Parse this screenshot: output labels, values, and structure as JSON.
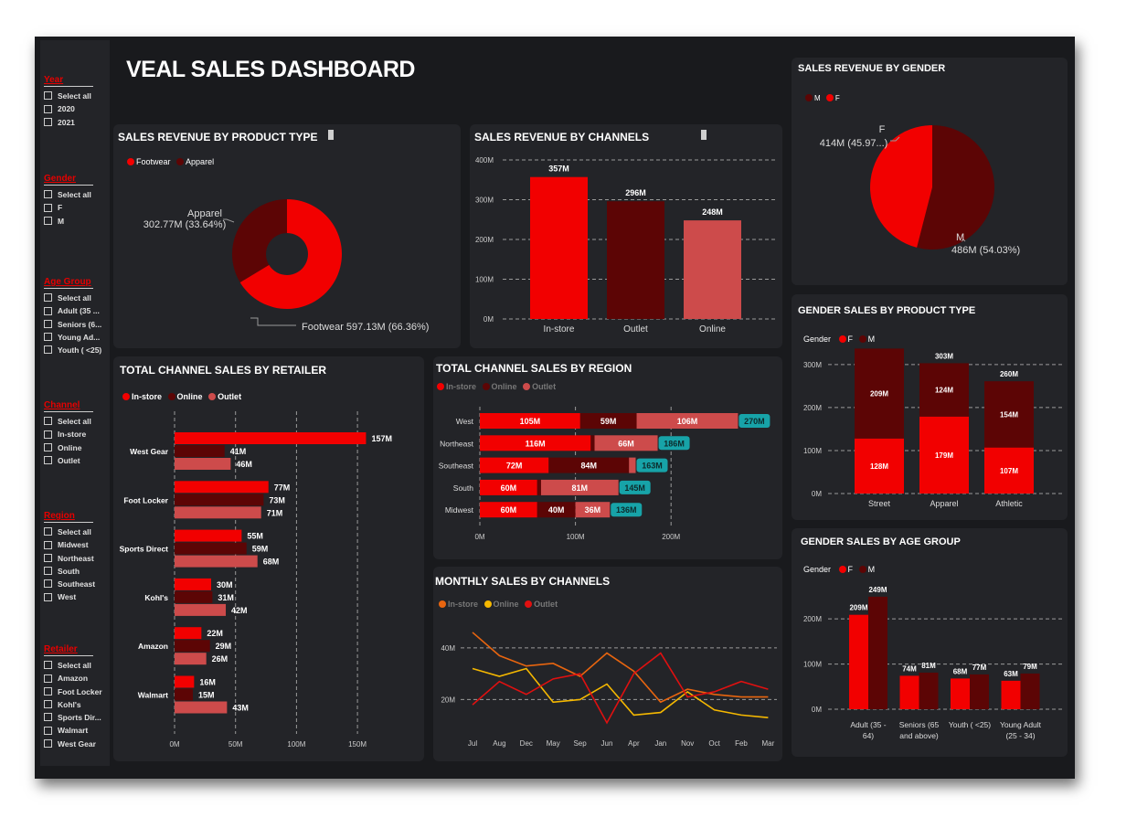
{
  "dashboard_title": "VEAL SALES DASHBOARD",
  "colors": {
    "instore": "#f20000",
    "online": "#5c0505",
    "outlet": "#cd4b4b",
    "female": "#f20000",
    "male": "#5c0505",
    "total": "#17a3a8",
    "monthly_instore": "#e8650f",
    "monthly_online": "#f5b800",
    "monthly_outlet": "#e01010"
  },
  "filters": [
    {
      "title": "Year",
      "items": [
        "Select all",
        "2020",
        "2021"
      ]
    },
    {
      "title": "Gender",
      "items": [
        "Select all",
        "F",
        "M"
      ]
    },
    {
      "title": "Age Group",
      "items": [
        "Select all",
        "Adult (35 ...",
        "Seniors (6...",
        "Young Ad...",
        "Youth ( <25)"
      ]
    },
    {
      "title": "Channel",
      "items": [
        "Select all",
        "In-store",
        "Online",
        "Outlet"
      ]
    },
    {
      "title": "Region",
      "items": [
        "Select all",
        "Midwest",
        "Northeast",
        "South",
        "Southeast",
        "West"
      ]
    },
    {
      "title": "Retailer",
      "items": [
        "Select all",
        "Amazon",
        "Foot Locker",
        "Kohl's",
        "Sports Dir...",
        "Walmart",
        "West Gear"
      ]
    }
  ],
  "panels": {
    "product_type": {
      "title": "SALES REVENUE BY PRODUCT TYPE",
      "legend": [
        "Footwear",
        "Apparel"
      ]
    },
    "channels": {
      "title": "SALES REVENUE BY CHANNELS"
    },
    "gender": {
      "title": "SALES REVENUE BY GENDER",
      "legend": [
        "M",
        "F"
      ]
    },
    "retailer": {
      "title": "TOTAL CHANNEL SALES BY RETAILER",
      "legend": [
        "In-store",
        "Online",
        "Outlet"
      ]
    },
    "region": {
      "title": "TOTAL CHANNEL SALES BY REGION",
      "legend": [
        "In-store",
        "Online",
        "Outlet"
      ]
    },
    "gender_product": {
      "title": "GENDER SALES BY PRODUCT TYPE",
      "legend_label": "Gender",
      "legend": [
        "F",
        "M"
      ]
    },
    "monthly": {
      "title": "MONTHLY SALES BY CHANNELS",
      "legend": [
        "In-store",
        "Online",
        "Outlet"
      ]
    },
    "gender_age": {
      "title": "GENDER SALES BY AGE GROUP",
      "legend_label": "Gender",
      "legend": [
        "F",
        "M"
      ]
    }
  },
  "chart_data": [
    {
      "id": "product_type",
      "type": "pie",
      "title": "SALES REVENUE BY PRODUCT TYPE",
      "donut": true,
      "slices": [
        {
          "name": "Footwear",
          "value": 597.13,
          "label": "Footwear 597.13M (66.36%)"
        },
        {
          "name": "Apparel",
          "value": 302.77,
          "label_name": "Apparel",
          "label": "302.77M (33.64%)"
        }
      ]
    },
    {
      "id": "channels",
      "type": "bar",
      "title": "SALES REVENUE BY CHANNELS",
      "categories": [
        "In-store",
        "Outlet",
        "Online"
      ],
      "values": [
        357,
        296,
        248
      ],
      "labels": [
        "357M",
        "296M",
        "248M"
      ],
      "yticks": [
        "0M",
        "100M",
        "200M",
        "300M",
        "400M"
      ],
      "ylim": [
        0,
        400
      ],
      "grid": true
    },
    {
      "id": "gender",
      "type": "pie",
      "title": "SALES REVENUE BY GENDER",
      "slices": [
        {
          "name": "M",
          "value": 486,
          "label": "486M (54.03%)"
        },
        {
          "name": "F",
          "value": 414,
          "label": "414M (45.97...)"
        }
      ]
    },
    {
      "id": "retailer",
      "type": "bar",
      "orientation": "horizontal",
      "title": "TOTAL CHANNEL SALES BY RETAILER",
      "categories": [
        "West Gear",
        "Foot Locker",
        "Sports Direct",
        "Kohl's",
        "Amazon",
        "Walmart"
      ],
      "series": [
        {
          "name": "In-store",
          "values": [
            157,
            77,
            55,
            30,
            22,
            16
          ],
          "labels": [
            "157M",
            "77M",
            "55M",
            "30M",
            "22M",
            "16M"
          ]
        },
        {
          "name": "Online",
          "values": [
            41,
            73,
            59,
            31,
            29,
            15
          ],
          "labels": [
            "41M",
            "73M",
            "59M",
            "31M",
            "29M",
            "15M"
          ]
        },
        {
          "name": "Outlet",
          "values": [
            46,
            71,
            68,
            42,
            26,
            43
          ],
          "labels": [
            "46M",
            "71M",
            "68M",
            "42M",
            "26M",
            "43M"
          ]
        }
      ],
      "xticks": [
        "0M",
        "50M",
        "100M",
        "150M"
      ],
      "xlim": [
        0,
        165
      ],
      "grid": true
    },
    {
      "id": "region",
      "type": "bar",
      "orientation": "horizontal",
      "stacked": true,
      "title": "TOTAL CHANNEL SALES BY REGION",
      "categories": [
        "West",
        "Northeast",
        "Southeast",
        "South",
        "Midwest"
      ],
      "series": [
        {
          "name": "In-store",
          "values": [
            105,
            116,
            72,
            60,
            60
          ],
          "labels": [
            "105M",
            "116M",
            "72M",
            "60M",
            "60M"
          ]
        },
        {
          "name": "Online",
          "values": [
            59,
            4,
            84,
            4,
            40
          ],
          "labels": [
            "59M",
            "",
            "84M",
            "",
            "40M"
          ]
        },
        {
          "name": "Outlet",
          "values": [
            106,
            66,
            7,
            81,
            36
          ],
          "labels": [
            "106M",
            "66M",
            "",
            "81M",
            "36M"
          ]
        }
      ],
      "totals": [
        "270M",
        "186M",
        "163M",
        "145M",
        "136M"
      ],
      "total_values": [
        270,
        186,
        163,
        145,
        136
      ],
      "xticks": [
        "0M",
        "100M",
        "200M"
      ],
      "xlim": [
        0,
        300
      ],
      "grid": true
    },
    {
      "id": "gender_product",
      "type": "bar",
      "stacked": true,
      "title": "GENDER SALES BY PRODUCT TYPE",
      "categories": [
        "Street",
        "Apparel",
        "Athletic"
      ],
      "series": [
        {
          "name": "F",
          "values": [
            128,
            179,
            107
          ],
          "labels": [
            "128M",
            "179M",
            "107M"
          ]
        },
        {
          "name": "M",
          "values": [
            209,
            124,
            154
          ],
          "labels": [
            "209M",
            "124M",
            "154M"
          ]
        }
      ],
      "totals": [
        "337M",
        "303M",
        "260M"
      ],
      "yticks": [
        "0M",
        "100M",
        "200M",
        "300M"
      ],
      "ylim": [
        0,
        340
      ],
      "grid": true
    },
    {
      "id": "monthly",
      "type": "line",
      "title": "MONTHLY SALES BY CHANNELS",
      "x": [
        "Jul",
        "Aug",
        "Dec",
        "May",
        "Sep",
        "Jun",
        "Apr",
        "Jan",
        "Nov",
        "Oct",
        "Feb",
        "Mar"
      ],
      "series": [
        {
          "name": "In-store",
          "values": [
            46,
            37,
            33,
            34,
            29,
            38,
            31,
            19,
            24,
            22,
            21,
            21
          ]
        },
        {
          "name": "Online",
          "values": [
            32,
            29,
            32,
            19,
            20,
            26,
            14,
            15,
            23,
            16,
            14,
            13
          ]
        },
        {
          "name": "Outlet",
          "values": [
            18,
            27,
            22,
            28,
            30,
            11,
            30,
            38,
            21,
            23,
            27,
            24
          ]
        }
      ],
      "yticks": [
        "20M",
        "40M"
      ],
      "ylim": [
        6,
        52
      ],
      "grid": true
    },
    {
      "id": "gender_age",
      "type": "bar",
      "title": "GENDER SALES BY AGE GROUP",
      "categories": [
        "Adult (35 - 64)",
        "Seniors (65 and above)",
        "Youth ( <25)",
        "Young Adult (25 - 34)"
      ],
      "category_lines": [
        [
          "Adult (35 -",
          "64)"
        ],
        [
          "Seniors (65",
          "and above)"
        ],
        [
          "Youth ( <25)"
        ],
        [
          "Young Adult",
          "(25 - 34)"
        ]
      ],
      "series": [
        {
          "name": "F",
          "values": [
            209,
            74,
            68,
            63
          ],
          "labels": [
            "209M",
            "74M",
            "68M",
            "63M"
          ]
        },
        {
          "name": "M",
          "values": [
            249,
            81,
            77,
            79
          ],
          "labels": [
            "249M",
            "81M",
            "77M",
            "79M"
          ]
        }
      ],
      "yticks": [
        "0M",
        "100M",
        "200M"
      ],
      "ylim": [
        0,
        265
      ],
      "grid": true
    }
  ]
}
